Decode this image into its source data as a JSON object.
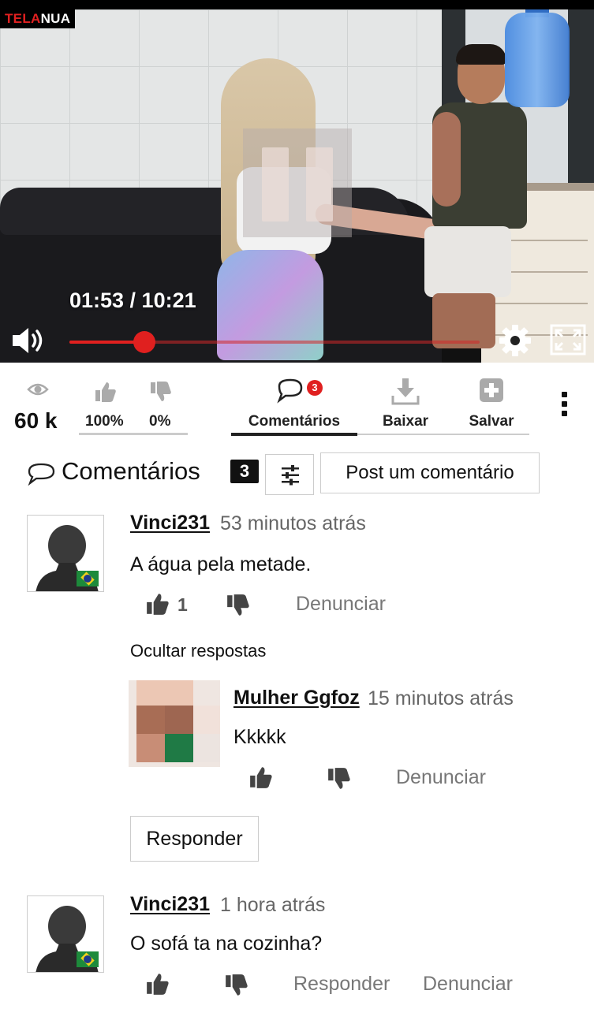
{
  "player": {
    "logo_part1": "TELA",
    "logo_part2": "NUA",
    "time_current": "01:53",
    "time_total": "10:21",
    "time_display": "01:53 / 10:21",
    "progress_fraction": 0.182,
    "state": "paused",
    "accent_color": "#e0201f"
  },
  "stats": {
    "views": "60 k",
    "like_pct": "100%",
    "dislike_pct": "0%"
  },
  "actions": {
    "comments_label": "Comentários",
    "comments_badge": "3",
    "download_label": "Baixar",
    "save_label": "Salvar"
  },
  "comments_section": {
    "title": "Comentários",
    "count": "3",
    "post_button": "Post um comentário",
    "hide_replies": "Ocultar respostas",
    "reply_button": "Responder"
  },
  "comments": [
    {
      "author": "Vinci231",
      "time": "53 minutos atrás",
      "text": "A água pela metade.",
      "likes": "1",
      "report": "Denunciar",
      "replies": [
        {
          "author": "Mulher Ggfoz",
          "time": "15 minutos atrás",
          "text": "Kkkkk",
          "report": "Denunciar"
        }
      ]
    },
    {
      "author": "Vinci231",
      "time": "1 hora atrás",
      "text": "O sofá ta na cozinha?",
      "reply": "Responder",
      "report": "Denunciar"
    }
  ],
  "icons": {
    "views": "eye-icon",
    "like": "thumbs-up-icon",
    "dislike": "thumbs-down-icon",
    "comments": "speech-bubble-icon",
    "download": "download-icon",
    "save": "plus-square-icon",
    "more": "vertical-dots-icon",
    "filter": "sliders-icon",
    "volume": "speaker-icon",
    "settings": "gear-icon",
    "fullscreen": "fullscreen-icon"
  }
}
